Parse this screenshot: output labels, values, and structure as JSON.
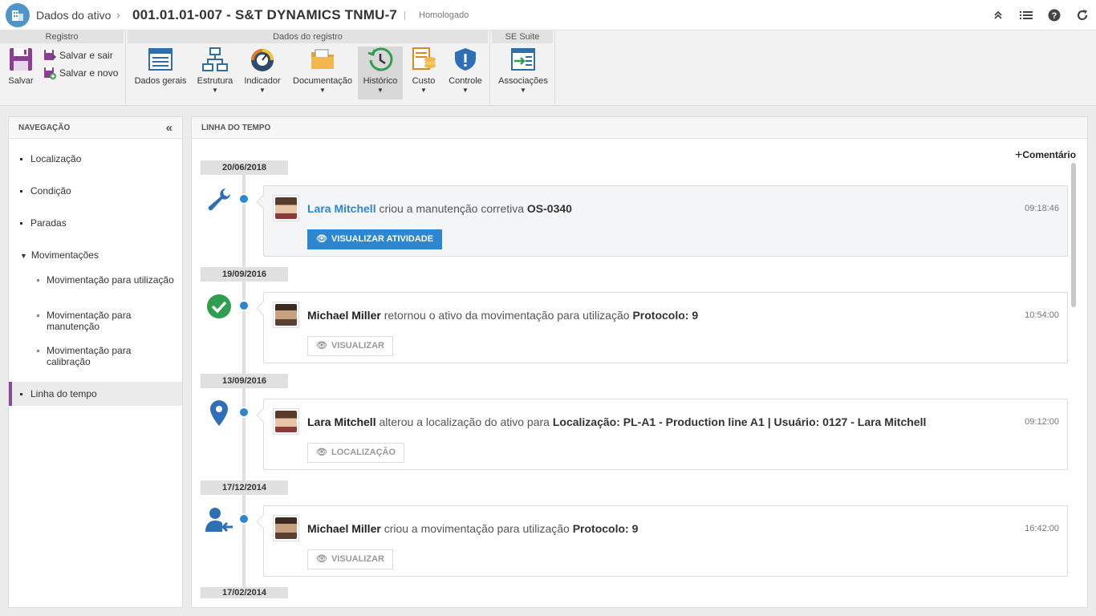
{
  "header": {
    "breadcrumb": "Dados do ativo",
    "separator": "›",
    "title": "001.01.01-007 - S&T DYNAMICS TNMU-7",
    "pipe": "|",
    "status": "Homologado"
  },
  "ribbon": {
    "groups": {
      "registro": "Registro",
      "dados": "Dados do registro",
      "suite": "SE Suite"
    },
    "salvar": "Salvar",
    "salvar_sair": "Salvar e sair",
    "salvar_novo": "Salvar e novo",
    "dados_gerais": "Dados gerais",
    "estrutura": "Estrutura",
    "indicador": "Indicador",
    "documentacao": "Documentação",
    "historico": "Histórico",
    "custo": "Custo",
    "controle": "Controle",
    "associacoes": "Associações"
  },
  "nav": {
    "title": "NAVEGAÇÃO",
    "items": [
      "Localização",
      "Condição",
      "Paradas",
      "Movimentações"
    ],
    "sub_items": [
      "Movimentação para utilização",
      "Movimentação para manutenção",
      "Movimentação para calibração"
    ],
    "active": "Linha do tempo"
  },
  "timeline": {
    "title": "LINHA DO TEMPO",
    "comment_button": "Comentário",
    "entries": [
      {
        "date": "20/06/2018",
        "icon": "wrench-icon",
        "user": "Lara Mitchell",
        "text": " criou a manutenção corretiva ",
        "bold": "OS-0340",
        "time": "09:18:46",
        "button": "VISUALIZAR ATIVIDADE"
      },
      {
        "date": "19/09/2016",
        "icon": "check-circle-icon",
        "user": "Michael Miller",
        "text": " retornou o ativo da movimentação para utilização ",
        "bold": "Protocolo: 9",
        "time": "10:54:00",
        "button": "VISUALIZAR"
      },
      {
        "date": "13/09/2016",
        "icon": "map-pin-icon",
        "user": "Lara Mitchell",
        "text": " alterou a localização do ativo para ",
        "bold": "Localização: PL-A1 - Production line A1 | Usuário: 0127 - Lara Mitchell",
        "time": "09:12:00",
        "button": "LOCALIZAÇÃO"
      },
      {
        "date": "17/12/2014",
        "icon": "user-arrow-icon",
        "user": "Michael Miller",
        "text": " criou a movimentação para utilização ",
        "bold": "Protocolo: 9",
        "time": "16:42:00",
        "button": "VISUALIZAR"
      },
      {
        "date": "17/02/2014"
      }
    ]
  },
  "colors": {
    "accent": "#2d86d1",
    "success": "#2e9e4f",
    "nav_active": "#8b4a9c"
  }
}
